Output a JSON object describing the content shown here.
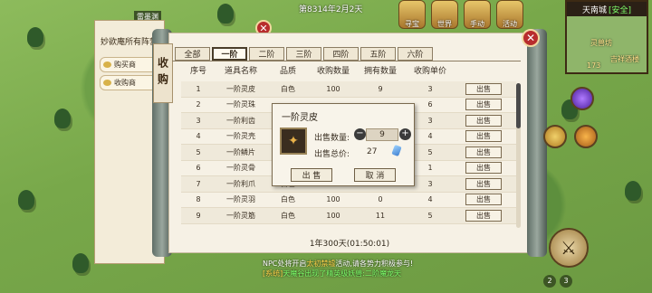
{
  "hud": {
    "date_text": "第8314年2月2天",
    "player_name": "雷墨渊",
    "icons": [
      {
        "name": "treasure-icon",
        "label": "寻宝"
      },
      {
        "name": "world-icon",
        "label": "世界"
      },
      {
        "name": "hand-icon",
        "label": "手动"
      },
      {
        "name": "activity-icon",
        "label": "活动"
      }
    ]
  },
  "minimap": {
    "city": "天南城",
    "safe": "[安全]",
    "labels": [
      "灵兽坊",
      "吉祥酒楼",
      "173"
    ]
  },
  "npc_dialog": {
    "text": "妙欲庵所有阵营",
    "options": [
      "购买商",
      "收购商"
    ]
  },
  "shop": {
    "side_title": "收购",
    "tabs": [
      "全部",
      "一阶",
      "二阶",
      "三阶",
      "四阶",
      "五阶",
      "六阶"
    ],
    "active_tab": "一阶",
    "columns": [
      "序号",
      "道具名称",
      "品质",
      "收购数量",
      "拥有数量",
      "收购单价",
      ""
    ],
    "rows": [
      {
        "no": "1",
        "name": "一阶灵皮",
        "quality": "白色",
        "buy_qty": "100",
        "own_qty": "9",
        "price": "3",
        "action": "出售"
      },
      {
        "no": "2",
        "name": "一阶灵珠",
        "quality": "",
        "buy_qty": "",
        "own_qty": "",
        "price": "6",
        "action": "出售"
      },
      {
        "no": "3",
        "name": "一阶利齿",
        "quality": "",
        "buy_qty": "",
        "own_qty": "",
        "price": "3",
        "action": "出售"
      },
      {
        "no": "4",
        "name": "一阶灵壳",
        "quality": "",
        "buy_qty": "",
        "own_qty": "",
        "price": "4",
        "action": "出售"
      },
      {
        "no": "5",
        "name": "一阶鳞片",
        "quality": "",
        "buy_qty": "",
        "own_qty": "",
        "price": "5",
        "action": "出售"
      },
      {
        "no": "6",
        "name": "一阶灵骨",
        "quality": "",
        "buy_qty": "",
        "own_qty": "",
        "price": "1",
        "action": "出售"
      },
      {
        "no": "7",
        "name": "一阶利爪",
        "quality": "白色",
        "buy_qty": "100",
        "own_qty": "5",
        "price": "3",
        "action": "出售"
      },
      {
        "no": "8",
        "name": "一阶灵羽",
        "quality": "白色",
        "buy_qty": "100",
        "own_qty": "0",
        "price": "4",
        "action": "出售"
      },
      {
        "no": "9",
        "name": "一阶灵筋",
        "quality": "白色",
        "buy_qty": "100",
        "own_qty": "11",
        "price": "5",
        "action": "出售"
      }
    ],
    "footer_time": "1年300天(01:50:01)"
  },
  "sell_popup": {
    "title": "一阶灵皮",
    "qty_label": "出售数量:",
    "qty_value": "9",
    "total_label": "出售总价:",
    "total_value": "27",
    "sell_label": "出 售",
    "cancel_label": "取 消"
  },
  "chat": {
    "line1_a": "NPC处将开启",
    "line1_b": "太初禁墟",
    "line1_c": "活动,请各势力积极参与!",
    "line2_a": "[系统]",
    "line2_b": "天魔谷出现了精英级妖兽:二阶魔龙天"
  },
  "skills": {
    "slot2": "2",
    "slot3": "3"
  }
}
